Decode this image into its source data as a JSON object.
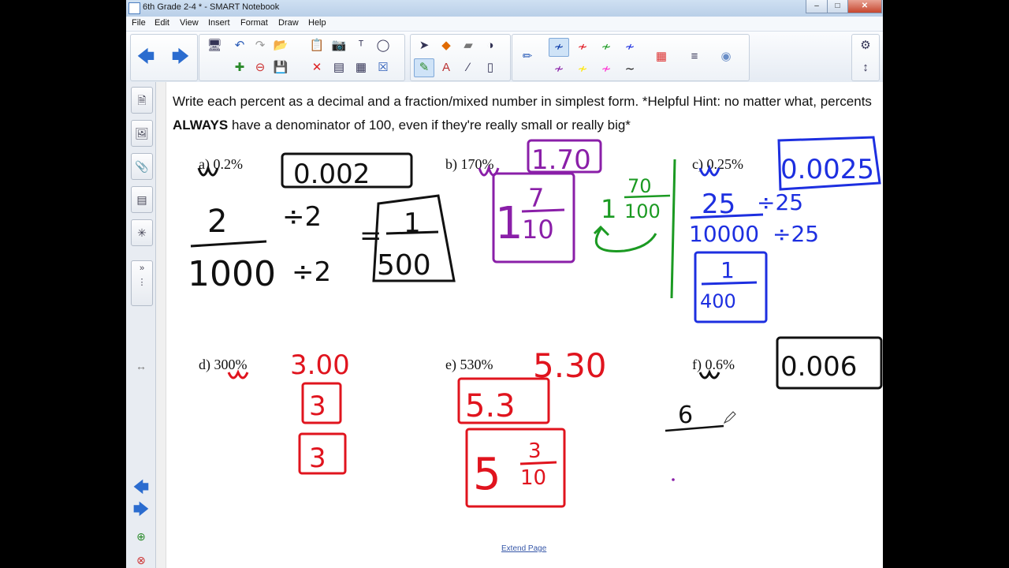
{
  "window": {
    "title": "6th Grade 2-4 * - SMART Notebook"
  },
  "menu": [
    "File",
    "Edit",
    "View",
    "Insert",
    "Format",
    "Draw",
    "Help"
  ],
  "page": {
    "instruction_pre": "Write each percent as a decimal and a fraction/mixed number in simplest form. *Helpful Hint: no matter what, percents ",
    "instruction_bold": "ALWAYS",
    "instruction_post": " have a denominator of 100, even if they're really small or really big*",
    "problems": [
      {
        "label": "a)",
        "value": "0.2%"
      },
      {
        "label": "b)",
        "value": "170%"
      },
      {
        "label": "c)",
        "value": "0.25%"
      },
      {
        "label": "d)",
        "value": "300%"
      },
      {
        "label": "e)",
        "value": "530%"
      },
      {
        "label": "f)",
        "value": "0.6%"
      }
    ],
    "extend_link": "Extend Page"
  },
  "ink": {
    "a_decimal": "0.002",
    "a_fraction_num": "2",
    "a_fraction_den": "1000",
    "a_div": "÷2",
    "a_equals": "=",
    "a_result_num": "1",
    "a_result_den": "500",
    "b_decimal": "1.70",
    "b_whole": "1",
    "b_num": "7",
    "b_den": "10",
    "b_green_whole": "1",
    "b_green_num": "70",
    "b_green_den": "100",
    "c_decimal": "0.0025",
    "c_num": "25",
    "c_den": "10000",
    "c_div": "÷25",
    "c_result_num": "1",
    "c_result_den": "400",
    "d_decimal": "3.00",
    "d_box1": "3",
    "d_box2": "3",
    "e_decimal": "5.30",
    "e_box1": "5.3",
    "e_whole": "5",
    "e_num": "3",
    "e_den": "10",
    "f_decimal": "0.006",
    "f_num": "6"
  },
  "colors": {
    "red": "#e0141e",
    "blue": "#1d2fe0",
    "green": "#1b9a22",
    "purple": "#8a1fa8",
    "black": "#111111",
    "yellow": "#ffe600",
    "magenta": "#ff2fd0"
  }
}
